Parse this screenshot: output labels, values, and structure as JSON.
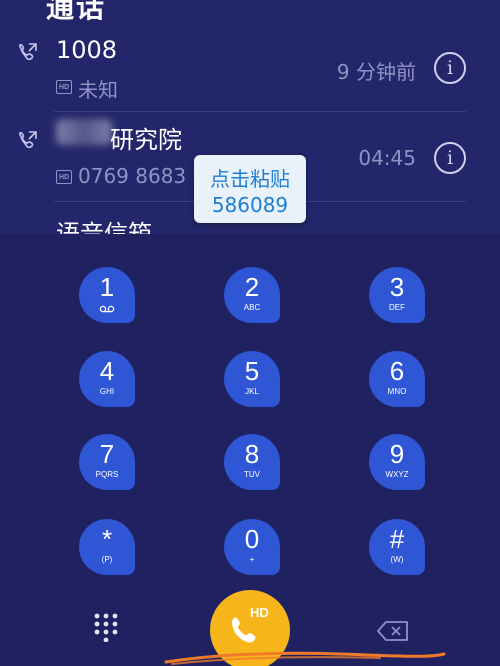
{
  "header": {
    "title_partial": "通话"
  },
  "call_log": [
    {
      "name": "1008",
      "badge": "HD",
      "subtitle": "未知",
      "time": "9 分钟前"
    },
    {
      "name_visible": "研究院",
      "badge": "HD",
      "subtitle": "0769 8683 6",
      "time": "04:45"
    },
    {
      "name": "语音信箱"
    }
  ],
  "paste_tooltip": {
    "line1": "点击粘贴",
    "line2": "586089"
  },
  "keypad": {
    "keys": [
      {
        "digit": "1",
        "letters": ""
      },
      {
        "digit": "2",
        "letters": "ABC"
      },
      {
        "digit": "3",
        "letters": "DEF"
      },
      {
        "digit": "4",
        "letters": "GHI"
      },
      {
        "digit": "5",
        "letters": "JKL"
      },
      {
        "digit": "6",
        "letters": "MNO"
      },
      {
        "digit": "7",
        "letters": "PQRS"
      },
      {
        "digit": "8",
        "letters": "TUV"
      },
      {
        "digit": "9",
        "letters": "WXYZ"
      },
      {
        "digit": "*",
        "letters": "(P)"
      },
      {
        "digit": "0",
        "letters": "+"
      },
      {
        "digit": "#",
        "letters": "(W)"
      }
    ]
  },
  "bottom_bar": {
    "call_badge": "HD"
  },
  "colors": {
    "background": "#1f2160",
    "call_log_bg": "#23266a",
    "key_blue": "#2f56d4",
    "call_button": "#f7b51c",
    "tooltip_text": "#1d7fd1",
    "scribble": "#f07a2a"
  },
  "icons": [
    "outgoing-call-icon",
    "info-icon",
    "voicemail-icon",
    "dialpad-toggle-icon",
    "phone-icon",
    "backspace-icon"
  ]
}
